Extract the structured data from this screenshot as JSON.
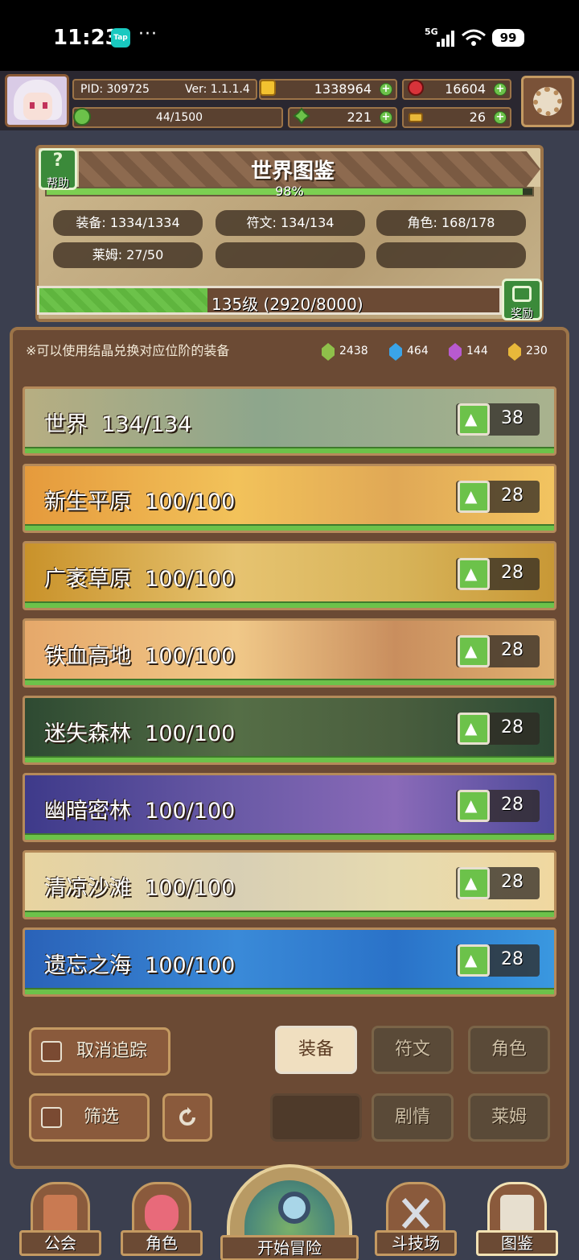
{
  "status_bar": {
    "time": "11:23",
    "tap_badge": "Tap",
    "dots": "···",
    "network": "5G",
    "battery": "99"
  },
  "hud": {
    "pid": "PID: 309725",
    "version": "Ver: 1.1.1.4",
    "stamina": "44/1500",
    "gold": "1338964",
    "ruby": "16604",
    "clover": "221",
    "key": "26",
    "plus": "+"
  },
  "codex": {
    "title": "世界图鉴",
    "help_label": "帮助",
    "help_icon": "?",
    "completion_percent": "98%",
    "completion_value": 0.98,
    "stats": {
      "equipment": "装备: 1334/1334",
      "runes": "符文: 134/134",
      "characters": "角色: 168/178",
      "slimes": "莱姆: 27/50"
    },
    "level_text": "135级 (2920/8000)",
    "level_progress": 0.365,
    "reward_label": "奖励"
  },
  "notice": {
    "text": "※可以使用结晶兑换对应位阶的装备",
    "crystals": [
      {
        "icon": "green-crystal-icon",
        "color": "#8fc04a",
        "count": "2438"
      },
      {
        "icon": "blue-crystal-icon",
        "color": "#3aa4e8",
        "count": "464"
      },
      {
        "icon": "purple-crystal-icon",
        "color": "#b85ad0",
        "count": "144"
      },
      {
        "icon": "gold-crystal-icon",
        "color": "#e8b83a",
        "count": "230"
      }
    ]
  },
  "regions": [
    {
      "name": "世界  134/134",
      "likes": "38",
      "bg": "linear-gradient(90deg,#b7ae82,#8da68c 45%,#a9b28e)"
    },
    {
      "name": "新生平原  100/100",
      "likes": "28",
      "bg": "linear-gradient(90deg,#e59a3c,#f2c25a 40%,#e0a856 70%,#f2c460)"
    },
    {
      "name": "广袤草原  100/100",
      "likes": "28",
      "bg": "linear-gradient(90deg,#c9922a,#e6c370 40%,#d8b45a 70%,#c89836)"
    },
    {
      "name": "铁血高地  100/100",
      "likes": "28",
      "bg": "linear-gradient(90deg,#e6a86a,#f0c888 40%,#c98e5e 70%,#e0b070)"
    },
    {
      "name": "迷失森林  100/100",
      "likes": "28",
      "bg": "linear-gradient(90deg,#2e4a32,#556e46 40%,#4a5e3e 70%,#2c4a34)"
    },
    {
      "name": "幽暗密林  100/100",
      "likes": "28",
      "bg": "linear-gradient(90deg,#3e3a8a,#6a5aa6 40%,#8a6ab8 70%,#4e4a9a)"
    },
    {
      "name": "清凉沙滩  100/100",
      "likes": "28",
      "bg": "linear-gradient(90deg,#e8d4a0,#d8cfb4 40%,#e6dab0 70%,#f0d8a0)"
    },
    {
      "name": "遗忘之海  100/100",
      "likes": "28",
      "bg": "linear-gradient(90deg,#2a62b8,#3a8ad8 40%,#2a72c8 70%,#3a98e0)"
    }
  ],
  "controls": {
    "untrack": "取消追踪",
    "filter": "筛选",
    "tab_equipment": "装备",
    "tab_runes": "符文",
    "tab_characters": "角色",
    "tab_story": "剧情",
    "tab_slimes": "莱姆"
  },
  "bottom_nav": {
    "guild": "公会",
    "character": "角色",
    "start_adventure": "开始冒险",
    "arena": "斗技场",
    "codex": "图鉴"
  },
  "colors": {
    "accent_green": "#6cc24a",
    "panel_brown": "#6b4a34",
    "frame_tan": "#c49a62"
  }
}
